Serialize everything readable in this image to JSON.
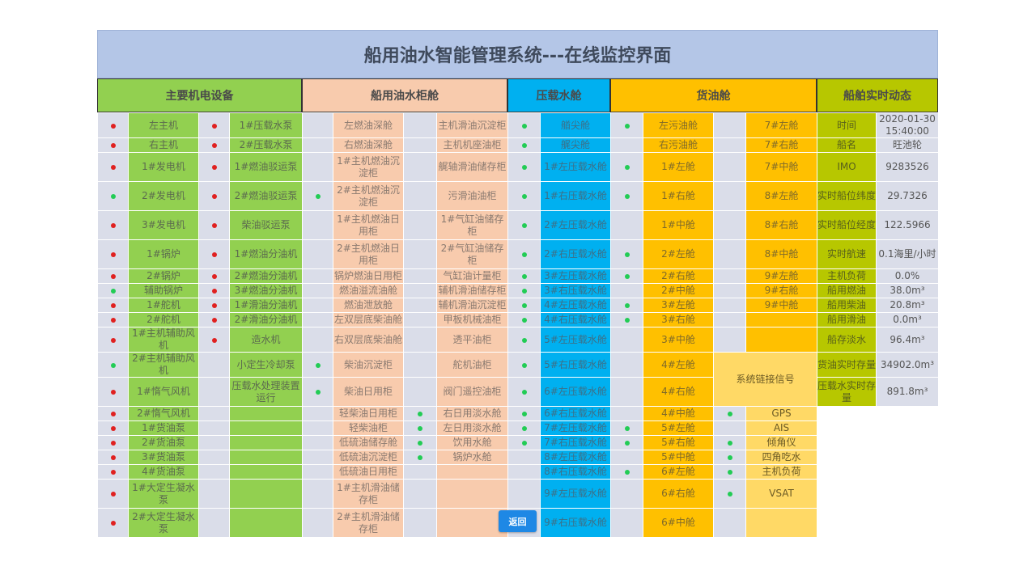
{
  "title": "船用油水智能管理系统---在线监控界面",
  "sections": [
    {
      "label": "主要机电设备"
    },
    {
      "label": "船用油水柜舱"
    },
    {
      "label": "压载水舱"
    },
    {
      "label": "货油舱"
    },
    {
      "label": "船舶实时动态"
    }
  ],
  "colors": {
    "equipment": "#92d050",
    "tanks": "#f8cbad",
    "ballast": "#00b0f0",
    "cargo": "#ffc000",
    "dynamic": "#b7c700",
    "status_red": "#e02020",
    "status_green": "#22cc55"
  },
  "equipment": [
    {
      "s1": "red",
      "n1": "左主机",
      "s2": "red",
      "n2": "1#压载水泵"
    },
    {
      "s1": "red",
      "n1": "右主机",
      "s2": "red",
      "n2": "2#压载水泵"
    },
    {
      "s1": "red",
      "n1": "1#发电机",
      "s2": "red",
      "n2": "1#燃油驳运泵"
    },
    {
      "s1": "green",
      "n1": "2#发电机",
      "s2": "red",
      "n2": "2#燃油驳运泵"
    },
    {
      "s1": "red",
      "n1": "3#发电机",
      "s2": "red",
      "n2": "柴油驳运泵"
    },
    {
      "s1": "red",
      "n1": "1#锅炉",
      "s2": "red",
      "n2": "1#燃油分油机"
    },
    {
      "s1": "red",
      "n1": "2#锅炉",
      "s2": "red",
      "n2": "2#燃油分油机"
    },
    {
      "s1": "green",
      "n1": "辅助锅炉",
      "s2": "red",
      "n2": "3#燃油分油机"
    },
    {
      "s1": "red",
      "n1": "1#舵机",
      "s2": "red",
      "n2": "1#滑油分油机"
    },
    {
      "s1": "red",
      "n1": "2#舵机",
      "s2": "red",
      "n2": "2#滑油分油机"
    },
    {
      "s1": "red",
      "n1": "1#主机辅助风机",
      "s2": "red",
      "n2": "造水机"
    },
    {
      "s1": "green",
      "n1": "2#主机辅助风机",
      "s2": "",
      "n2": "小定生冷却泵"
    },
    {
      "s1": "red",
      "n1": "1#惰气风机",
      "s2": "",
      "n2": "压载水处理装置运行"
    },
    {
      "s1": "red",
      "n1": "2#惰气风机",
      "s2": "",
      "n2": ""
    },
    {
      "s1": "red",
      "n1": "1#货油泵",
      "s2": "",
      "n2": ""
    },
    {
      "s1": "red",
      "n1": "2#货油泵",
      "s2": "",
      "n2": ""
    },
    {
      "s1": "red",
      "n1": "3#货油泵",
      "s2": "",
      "n2": ""
    },
    {
      "s1": "red",
      "n1": "4#货油泵",
      "s2": "",
      "n2": ""
    },
    {
      "s1": "red",
      "n1": "1#大定生凝水泵",
      "s2": "",
      "n2": ""
    },
    {
      "s1": "red",
      "n1": "2#大定生凝水泵",
      "s2": "",
      "n2": ""
    }
  ],
  "tanks": [
    {
      "s1": "",
      "n1": "左燃油深舱",
      "s2": "",
      "n2": "主机滑油沉淀柜"
    },
    {
      "s1": "",
      "n1": "右燃油深舱",
      "s2": "",
      "n2": "主机机座油柜"
    },
    {
      "s1": "",
      "n1": "1#主机燃油沉淀柜",
      "s2": "",
      "n2": "艉轴滑油储存柜"
    },
    {
      "s1": "green",
      "n1": "2#主机燃油沉淀柜",
      "s2": "",
      "n2": "污滑油油柜"
    },
    {
      "s1": "",
      "n1": "1#主机燃油日用柜",
      "s2": "",
      "n2": "1#气缸油储存柜"
    },
    {
      "s1": "",
      "n1": "2#主机燃油日用柜",
      "s2": "",
      "n2": "2#气缸油储存柜"
    },
    {
      "s1": "",
      "n1": "锅炉燃油日用柜",
      "s2": "",
      "n2": "气缸油计量柜"
    },
    {
      "s1": "",
      "n1": "燃油溢流油舱",
      "s2": "",
      "n2": "辅机滑油储存柜"
    },
    {
      "s1": "",
      "n1": "燃油泄放舱",
      "s2": "",
      "n2": "辅机滑油沉淀柜"
    },
    {
      "s1": "",
      "n1": "左双层底柴油舱",
      "s2": "",
      "n2": "甲板机械油柜"
    },
    {
      "s1": "",
      "n1": "右双层底柴油舱",
      "s2": "",
      "n2": "透平油柜"
    },
    {
      "s1": "green",
      "n1": "柴油沉淀柜",
      "s2": "",
      "n2": "舵机油柜"
    },
    {
      "s1": "green",
      "n1": "柴油日用柜",
      "s2": "",
      "n2": "阀门遥控油柜"
    },
    {
      "s1": "",
      "n1": "轻柴油日用柜",
      "s2": "green",
      "n2": "右日用淡水舱"
    },
    {
      "s1": "",
      "n1": "轻柴油柜",
      "s2": "green",
      "n2": "左日用淡水舱"
    },
    {
      "s1": "",
      "n1": "低硫油储存舱",
      "s2": "green",
      "n2": "饮用水舱"
    },
    {
      "s1": "",
      "n1": "低硫油沉淀柜",
      "s2": "green",
      "n2": "锅炉水舱"
    },
    {
      "s1": "",
      "n1": "低硫油日用柜",
      "s2": "",
      "n2": ""
    },
    {
      "s1": "",
      "n1": "1#主机滑油储存柜",
      "s2": "",
      "n2": ""
    },
    {
      "s1": "",
      "n1": "2#主机滑油储存柜",
      "s2": "",
      "n2": ""
    }
  ],
  "ballast": [
    {
      "s": "green",
      "n": "艏尖舱"
    },
    {
      "s": "green",
      "n": "艉尖舱"
    },
    {
      "s": "green",
      "n": "1#左压载水舱"
    },
    {
      "s": "green",
      "n": "1#右压载水舱"
    },
    {
      "s": "green",
      "n": "2#左压载水舱"
    },
    {
      "s": "green",
      "n": "2#右压载水舱"
    },
    {
      "s": "green",
      "n": "3#左压载水舱"
    },
    {
      "s": "green",
      "n": "3#右压载水舱"
    },
    {
      "s": "green",
      "n": "4#左压载水舱"
    },
    {
      "s": "green",
      "n": "4#右压载水舱"
    },
    {
      "s": "green",
      "n": "5#左压载水舱"
    },
    {
      "s": "green",
      "n": "5#右压载水舱"
    },
    {
      "s": "green",
      "n": "6#左压载水舱"
    },
    {
      "s": "green",
      "n": "6#右压载水舱"
    },
    {
      "s": "green",
      "n": "7#左压载水舱"
    },
    {
      "s": "green",
      "n": "7#右压载水舱"
    },
    {
      "s": "",
      "n": "8#左压载水舱"
    },
    {
      "s": "",
      "n": "8#右压载水舱"
    },
    {
      "s": "",
      "n": "9#左压载水舱"
    },
    {
      "s": "",
      "n": "9#右压载水舱"
    }
  ],
  "cargo": [
    {
      "s": "green",
      "n": "左污油舱",
      "n2": "7#左舱"
    },
    {
      "s": "",
      "n": "右污油舱",
      "n2": "7#右舱"
    },
    {
      "s": "green",
      "n": "1#左舱",
      "n2": "7#中舱"
    },
    {
      "s": "green",
      "n": "1#右舱",
      "n2": "8#左舱"
    },
    {
      "s": "",
      "n": "1#中舱",
      "n2": "8#右舱"
    },
    {
      "s": "green",
      "n": "2#左舱",
      "n2": "8#中舱"
    },
    {
      "s": "green",
      "n": "2#右舱",
      "n2": "9#左舱"
    },
    {
      "s": "",
      "n": "2#中舱",
      "n2": "9#右舱"
    },
    {
      "s": "green",
      "n": "3#左舱",
      "n2": "9#中舱"
    },
    {
      "s": "green",
      "n": "3#右舱",
      "n2": ""
    },
    {
      "s": "",
      "n": "3#中舱",
      "n2": ""
    },
    {
      "s": "",
      "n": "4#左舱"
    },
    {
      "s": "",
      "n": "4#右舱"
    },
    {
      "s": "",
      "n": "4#中舱"
    },
    {
      "s": "green",
      "n": "5#左舱"
    },
    {
      "s": "green",
      "n": "5#右舱"
    },
    {
      "s": "",
      "n": "5#中舱"
    },
    {
      "s": "green",
      "n": "6#左舱"
    },
    {
      "s": "",
      "n": "6#右舱"
    },
    {
      "s": "",
      "n": "6#中舱"
    }
  ],
  "signals": {
    "header": "系统链接信号",
    "items": [
      {
        "s": "green",
        "n": "GPS"
      },
      {
        "s": "",
        "n": "AIS"
      },
      {
        "s": "green",
        "n": "倾角仪"
      },
      {
        "s": "green",
        "n": "四角吃水"
      },
      {
        "s": "green",
        "n": "主机负荷"
      },
      {
        "s": "green",
        "n": "VSAT"
      },
      {
        "s": "",
        "n": ""
      }
    ]
  },
  "dynamics": [
    {
      "label": "时间",
      "value": "2020-01-30 15:40:00"
    },
    {
      "label": "船名",
      "value": "旺池轮"
    },
    {
      "label": "IMO",
      "value": "9283526"
    },
    {
      "label": "实时船位纬度",
      "value": "29.7326"
    },
    {
      "label": "实时船位经度",
      "value": "122.5966"
    },
    {
      "label": "实时航速",
      "value": "0.1海里/小时"
    },
    {
      "label": "主机负荷",
      "value": "0.0%"
    },
    {
      "label": "船用燃油",
      "value": "38.0m³"
    },
    {
      "label": "船用柴油",
      "value": "20.8m³"
    },
    {
      "label": "船用滑油",
      "value": "0.0m³"
    },
    {
      "label": "船存淡水",
      "value": "96.4m³"
    },
    {
      "label": "货油实时存量",
      "value": "34902.0m³"
    },
    {
      "label": "压载水实时存量",
      "value": "891.8m³"
    }
  ],
  "back_button": "返回"
}
